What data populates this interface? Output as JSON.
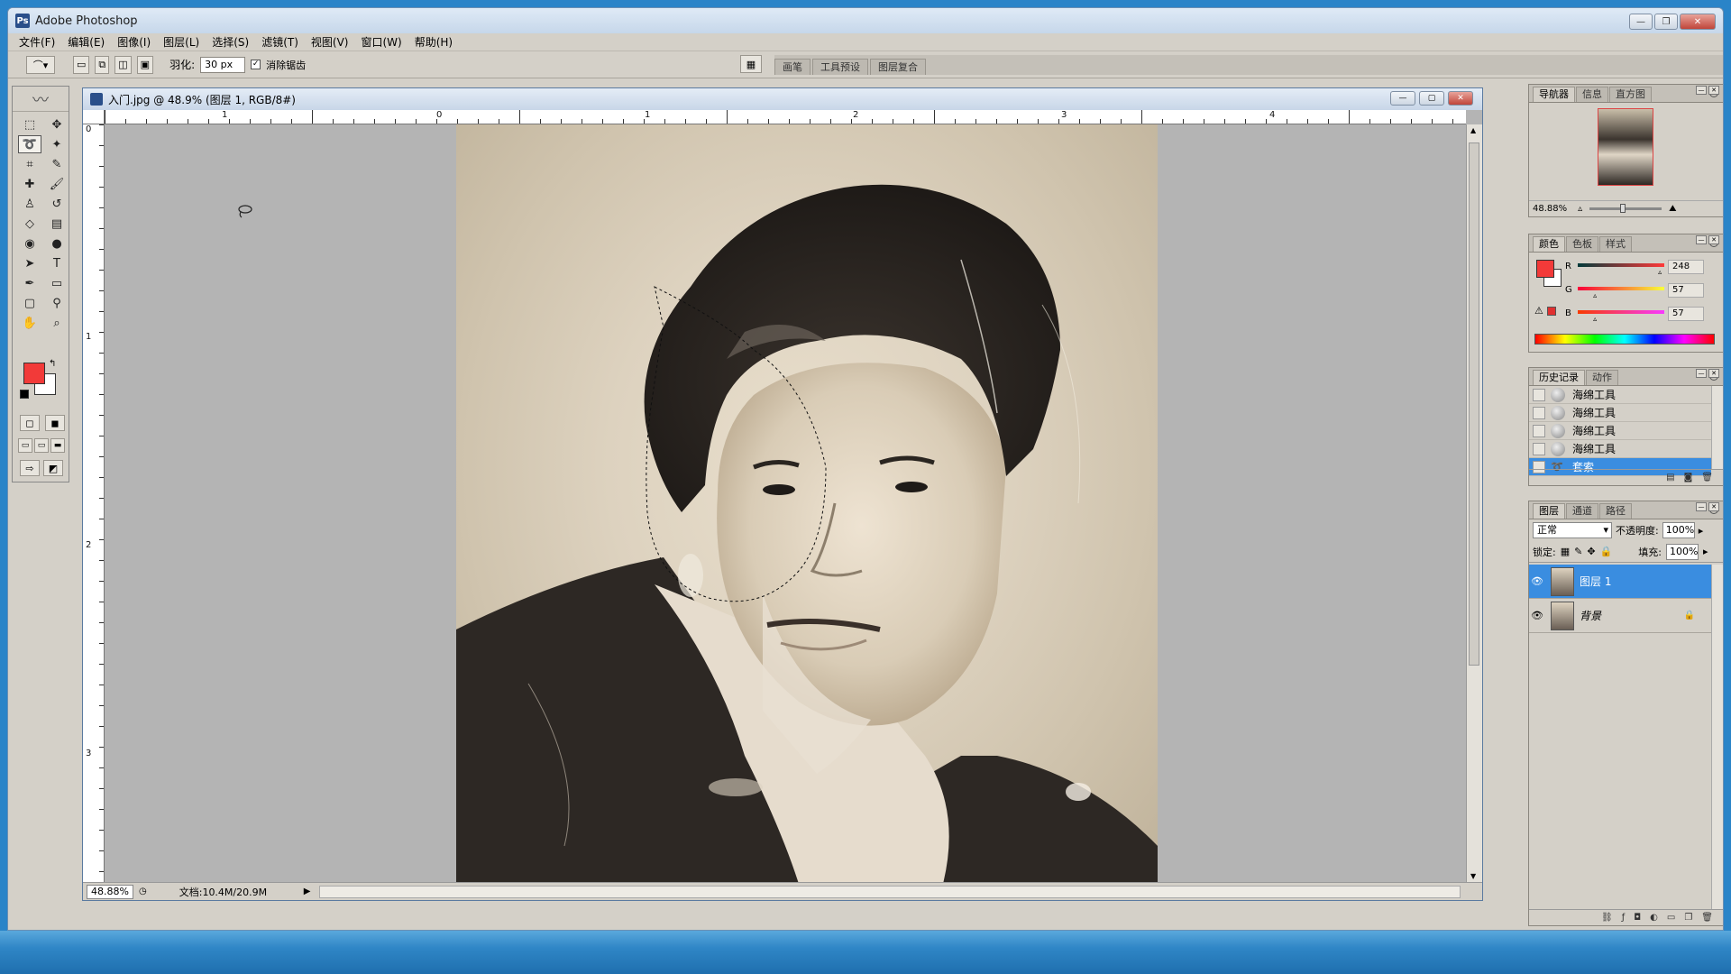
{
  "app": {
    "title": "Adobe Photoshop"
  },
  "menu": [
    "文件(F)",
    "编辑(E)",
    "图像(I)",
    "图层(L)",
    "选择(S)",
    "滤镜(T)",
    "视图(V)",
    "窗口(W)",
    "帮助(H)"
  ],
  "options": {
    "feather_label": "羽化:",
    "feather_value": "30 px",
    "antialias_label": "消除锯齿",
    "antialias_checked": true,
    "palette_tabs": [
      "画笔",
      "工具预设",
      "图层复合"
    ]
  },
  "document": {
    "title": "入门.jpg @ 48.9% (图层 1, RGB/8#)",
    "hruler_labels": [
      "1",
      "0",
      "1",
      "2",
      "3",
      "4"
    ],
    "vruler_labels": [
      "0",
      "1",
      "2",
      "3"
    ],
    "status_zoom": "48.88%",
    "status_doc": "文档:10.4M/20.9M"
  },
  "navigator": {
    "tabs": [
      "导航器",
      "信息",
      "直方图"
    ],
    "zoom": "48.88%"
  },
  "color": {
    "tabs": [
      "颜色",
      "色板",
      "样式"
    ],
    "foreground": "#f23a39",
    "channels": [
      {
        "label": "R",
        "value": "248",
        "level": 0.97
      },
      {
        "label": "G",
        "value": "57",
        "level": 0.22
      },
      {
        "label": "B",
        "value": "57",
        "level": 0.22
      }
    ]
  },
  "history": {
    "tabs": [
      "历史记录",
      "动作"
    ],
    "items": [
      "海绵工具",
      "海绵工具",
      "海绵工具",
      "海绵工具",
      "套索"
    ],
    "selected": 4
  },
  "layers": {
    "tabs": [
      "图层",
      "通道",
      "路径"
    ],
    "blend_mode": "正常",
    "opacity_label": "不透明度:",
    "opacity_value": "100%",
    "lock_label": "锁定:",
    "fill_label": "填充:",
    "fill_value": "100%",
    "items": [
      {
        "name": "图层 1",
        "selected": true,
        "locked": false
      },
      {
        "name": "背景",
        "selected": false,
        "locked": true
      }
    ]
  },
  "colors": {
    "selection": "#3a8de0",
    "chrome": "#d4d0c8",
    "canvas_bg": "#b4b4b4"
  }
}
